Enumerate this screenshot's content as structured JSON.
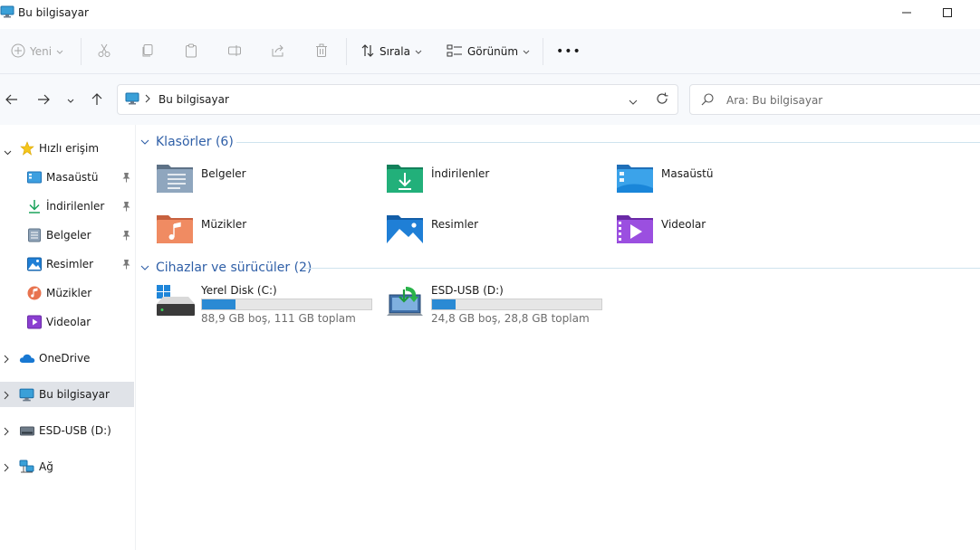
{
  "window": {
    "title": "Bu bilgisayar"
  },
  "toolbar": {
    "new_label": "Yeni",
    "sort_label": "Sırala",
    "view_label": "Görünüm",
    "more_label": "•••"
  },
  "address": {
    "segment": "Bu bilgisayar",
    "search_placeholder": "Ara: Bu bilgisayar"
  },
  "sidebar": {
    "quick_access": "Hızlı erişim",
    "pinned": [
      "Masaüstü",
      "İndirilenler",
      "Belgeler",
      "Resimler"
    ],
    "unpinned": [
      "Müzikler",
      "Videolar"
    ],
    "onedrive": "OneDrive",
    "this_pc": "Bu bilgisayar",
    "usb": "ESD-USB (D:)",
    "network": "Ağ"
  },
  "groups": {
    "folders_title": "Klasörler (6)",
    "devices_title": "Cihazlar ve sürücüler (2)"
  },
  "folders": [
    "Belgeler",
    "İndirilenler",
    "Masaüstü",
    "Müzikler",
    "Resimler",
    "Videolar"
  ],
  "drives": [
    {
      "name": "Yerel Disk (C:)",
      "info": "88,9 GB boş, 111 GB toplam",
      "used_fraction": 0.2
    },
    {
      "name": "ESD-USB (D:)",
      "info": "24,8 GB boş, 28,8 GB toplam",
      "used_fraction": 0.14
    }
  ],
  "colors": {
    "accent": "#2a8ad4",
    "group_header": "#2f5fa7",
    "selected_bg": "#e0e3e8"
  }
}
